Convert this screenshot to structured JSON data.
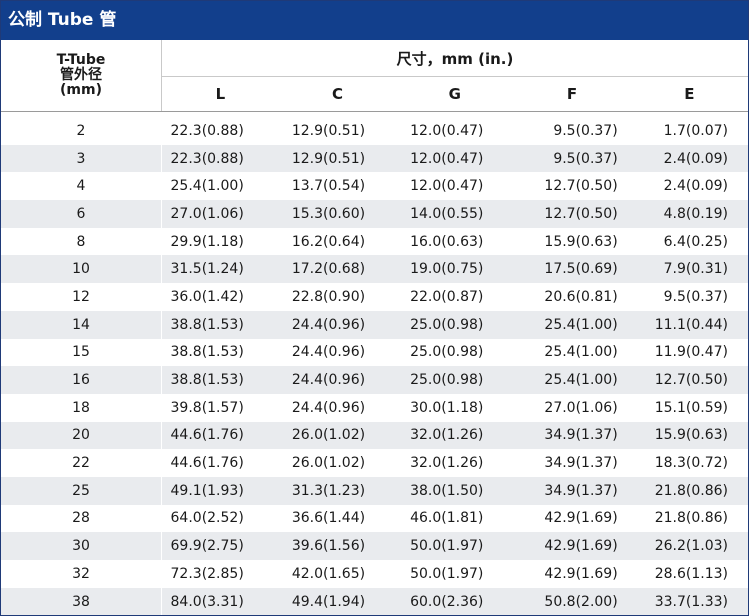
{
  "title": "公制 Tube 管",
  "header": {
    "od_line1": "T-Tube",
    "od_line2": "管外径",
    "od_line3": "(mm)",
    "dims_label": "尺寸，mm (in.)",
    "columns": [
      "L",
      "C",
      "G",
      "F",
      "E"
    ]
  },
  "rows": [
    [
      "2",
      "22.3(0.88)",
      "12.9(0.51)",
      "12.0(0.47)",
      "9.5(0.37)",
      "1.7(0.07)"
    ],
    [
      "3",
      "22.3(0.88)",
      "12.9(0.51)",
      "12.0(0.47)",
      "9.5(0.37)",
      "2.4(0.09)"
    ],
    [
      "4",
      "25.4(1.00)",
      "13.7(0.54)",
      "12.0(0.47)",
      "12.7(0.50)",
      "2.4(0.09)"
    ],
    [
      "6",
      "27.0(1.06)",
      "15.3(0.60)",
      "14.0(0.55)",
      "12.7(0.50)",
      "4.8(0.19)"
    ],
    [
      "8",
      "29.9(1.18)",
      "16.2(0.64)",
      "16.0(0.63)",
      "15.9(0.63)",
      "6.4(0.25)"
    ],
    [
      "10",
      "31.5(1.24)",
      "17.2(0.68)",
      "19.0(0.75)",
      "17.5(0.69)",
      "7.9(0.31)"
    ],
    [
      "12",
      "36.0(1.42)",
      "22.8(0.90)",
      "22.0(0.87)",
      "20.6(0.81)",
      "9.5(0.37)"
    ],
    [
      "14",
      "38.8(1.53)",
      "24.4(0.96)",
      "25.0(0.98)",
      "25.4(1.00)",
      "11.1(0.44)"
    ],
    [
      "15",
      "38.8(1.53)",
      "24.4(0.96)",
      "25.0(0.98)",
      "25.4(1.00)",
      "11.9(0.47)"
    ],
    [
      "16",
      "38.8(1.53)",
      "24.4(0.96)",
      "25.0(0.98)",
      "25.4(1.00)",
      "12.7(0.50)"
    ],
    [
      "18",
      "39.8(1.57)",
      "24.4(0.96)",
      "30.0(1.18)",
      "27.0(1.06)",
      "15.1(0.59)"
    ],
    [
      "20",
      "44.6(1.76)",
      "26.0(1.02)",
      "32.0(1.26)",
      "34.9(1.37)",
      "15.9(0.63)"
    ],
    [
      "22",
      "44.6(1.76)",
      "26.0(1.02)",
      "32.0(1.26)",
      "34.9(1.37)",
      "18.3(0.72)"
    ],
    [
      "25",
      "49.1(1.93)",
      "31.3(1.23)",
      "38.0(1.50)",
      "34.9(1.37)",
      "21.8(0.86)"
    ],
    [
      "28",
      "64.0(2.52)",
      "36.6(1.44)",
      "46.0(1.81)",
      "42.9(1.69)",
      "21.8(0.86)"
    ],
    [
      "30",
      "69.9(2.75)",
      "39.6(1.56)",
      "50.0(1.97)",
      "42.9(1.69)",
      "26.2(1.03)"
    ],
    [
      "32",
      "72.3(2.85)",
      "42.0(1.65)",
      "50.0(1.97)",
      "42.9(1.69)",
      "28.6(1.13)"
    ],
    [
      "38",
      "84.0(3.31)",
      "49.4(1.94)",
      "60.0(2.36)",
      "50.8(2.00)",
      "33.7(1.33)"
    ]
  ],
  "colors": {
    "title_bar": "#123f8c",
    "stripe": "#e9ebee"
  }
}
